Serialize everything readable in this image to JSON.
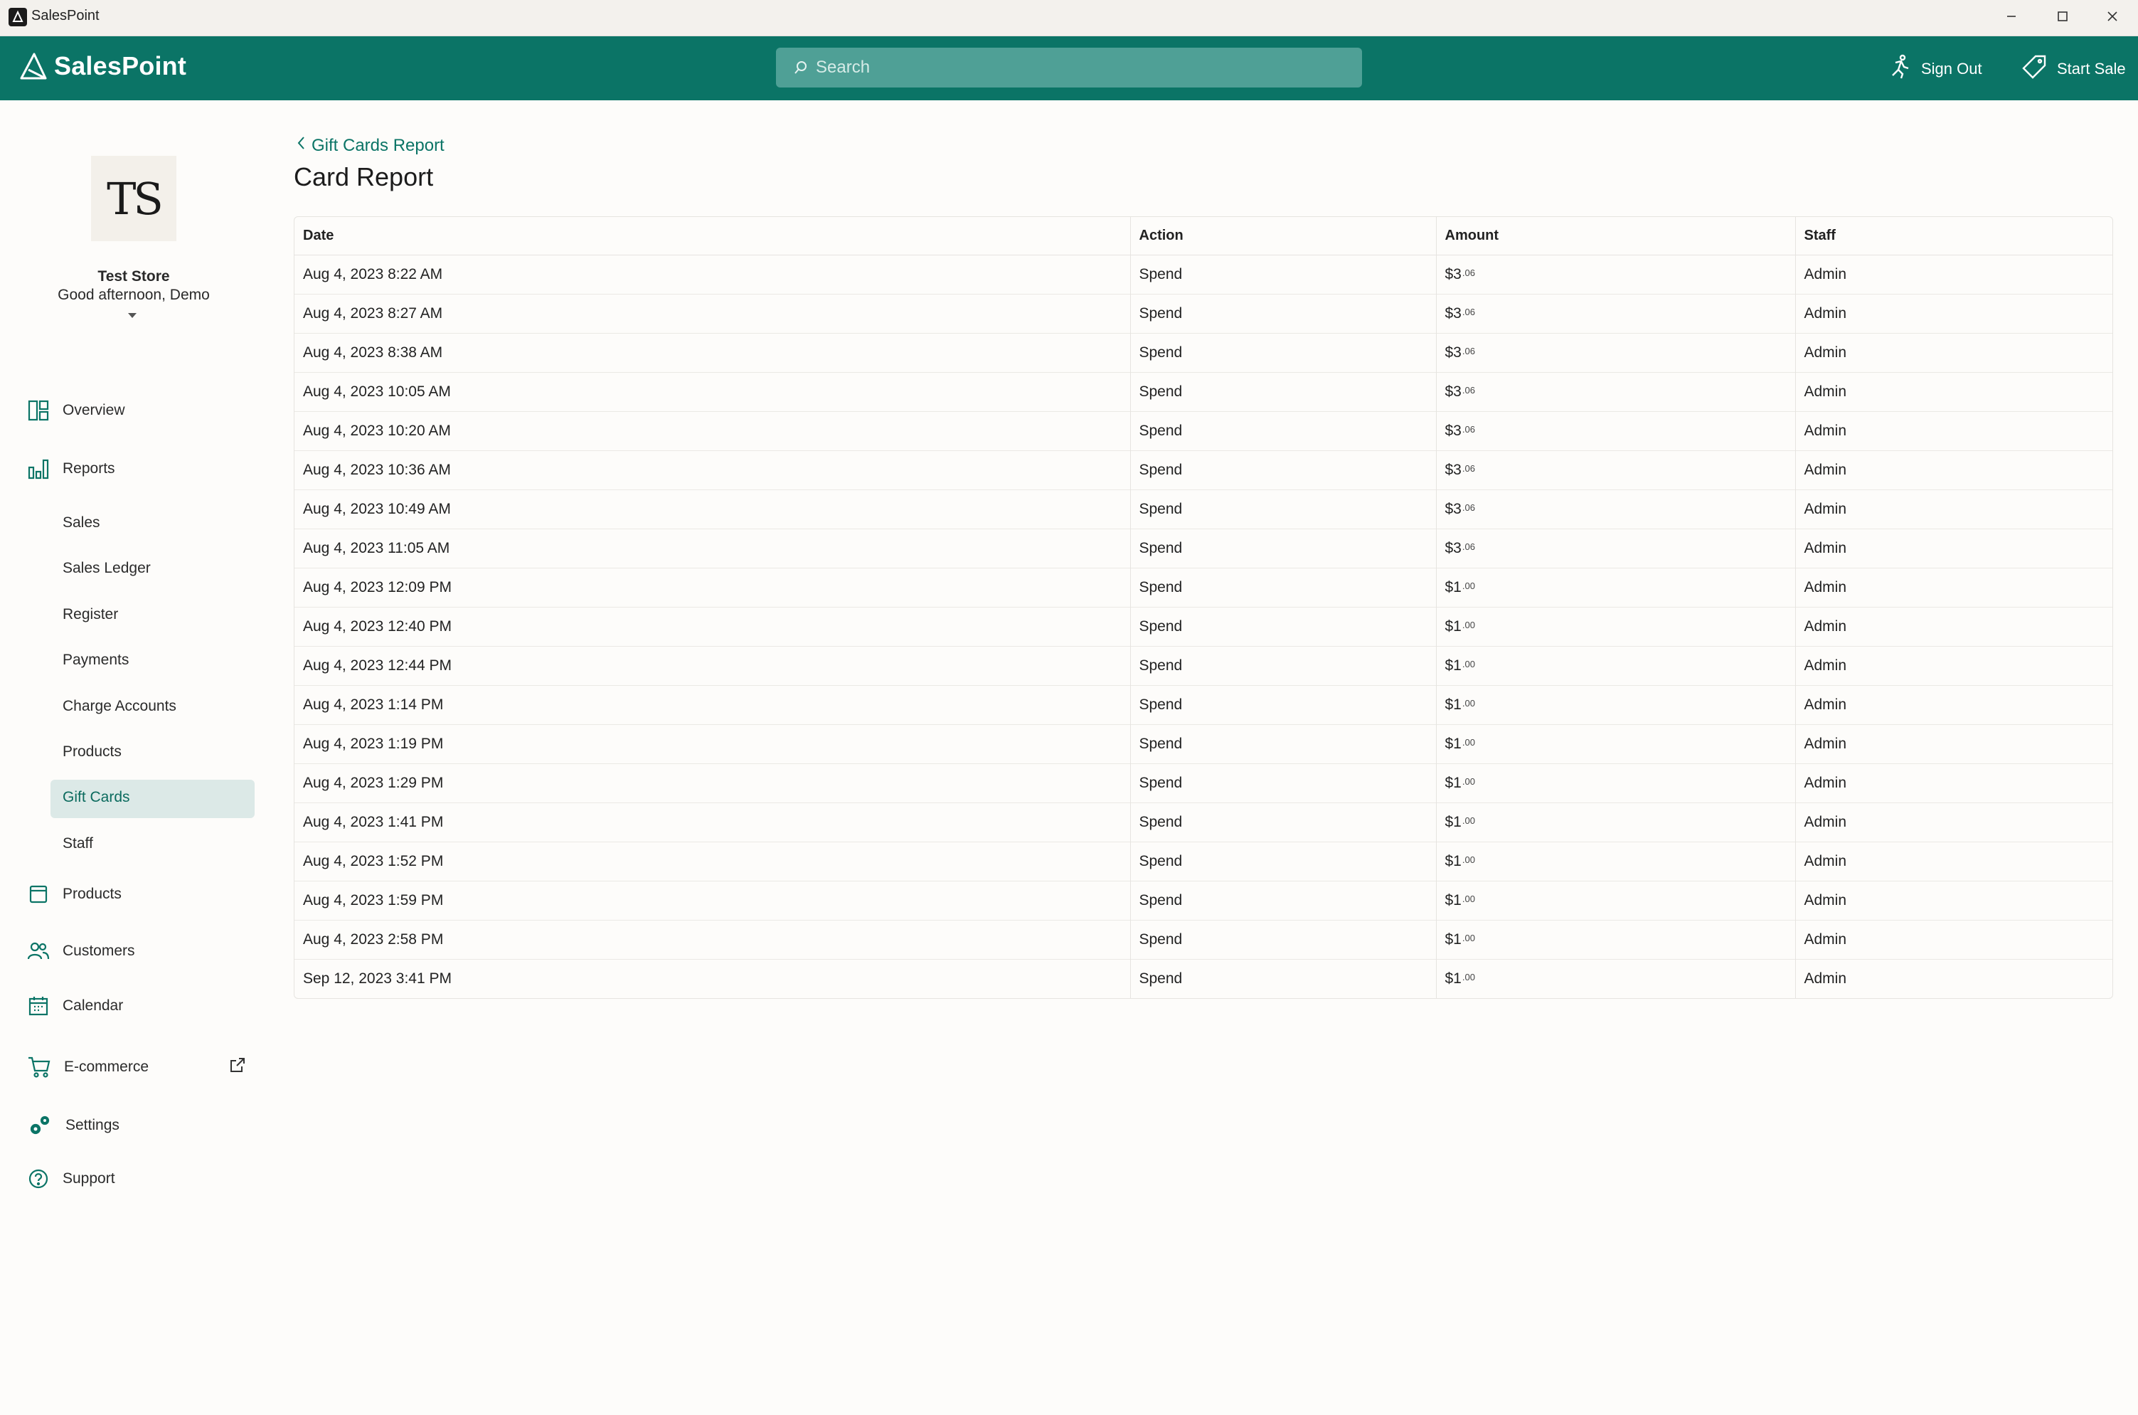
{
  "window": {
    "title": "SalesPoint"
  },
  "header": {
    "brand": "SalesPoint",
    "search_placeholder": "Search",
    "sign_out": "Sign Out",
    "start_sale": "Start Sale"
  },
  "store": {
    "initials": "TS",
    "name": "Test Store",
    "greeting": "Good afternoon, Demo"
  },
  "nav": {
    "overview": "Overview",
    "reports": "Reports",
    "report_items": [
      "Sales",
      "Sales Ledger",
      "Register",
      "Payments",
      "Charge Accounts",
      "Products",
      "Gift Cards",
      "Staff"
    ],
    "active_report_item": "Gift Cards",
    "products": "Products",
    "customers": "Customers",
    "calendar": "Calendar",
    "ecommerce": "E-commerce",
    "settings": "Settings",
    "support": "Support"
  },
  "main": {
    "back_link": "Gift Cards Report",
    "title": "Card Report",
    "columns": [
      "Date",
      "Action",
      "Amount",
      "Staff"
    ],
    "rows": [
      {
        "date": "Aug 4, 2023 8:22 AM",
        "action": "Spend",
        "dollars": "$3",
        "cents": ".06",
        "staff": "Admin"
      },
      {
        "date": "Aug 4, 2023 8:27 AM",
        "action": "Spend",
        "dollars": "$3",
        "cents": ".06",
        "staff": "Admin"
      },
      {
        "date": "Aug 4, 2023 8:38 AM",
        "action": "Spend",
        "dollars": "$3",
        "cents": ".06",
        "staff": "Admin"
      },
      {
        "date": "Aug 4, 2023 10:05 AM",
        "action": "Spend",
        "dollars": "$3",
        "cents": ".06",
        "staff": "Admin"
      },
      {
        "date": "Aug 4, 2023 10:20 AM",
        "action": "Spend",
        "dollars": "$3",
        "cents": ".06",
        "staff": "Admin"
      },
      {
        "date": "Aug 4, 2023 10:36 AM",
        "action": "Spend",
        "dollars": "$3",
        "cents": ".06",
        "staff": "Admin"
      },
      {
        "date": "Aug 4, 2023 10:49 AM",
        "action": "Spend",
        "dollars": "$3",
        "cents": ".06",
        "staff": "Admin"
      },
      {
        "date": "Aug 4, 2023 11:05 AM",
        "action": "Spend",
        "dollars": "$3",
        "cents": ".06",
        "staff": "Admin"
      },
      {
        "date": "Aug 4, 2023 12:09 PM",
        "action": "Spend",
        "dollars": "$1",
        "cents": ".00",
        "staff": "Admin"
      },
      {
        "date": "Aug 4, 2023 12:40 PM",
        "action": "Spend",
        "dollars": "$1",
        "cents": ".00",
        "staff": "Admin"
      },
      {
        "date": "Aug 4, 2023 12:44 PM",
        "action": "Spend",
        "dollars": "$1",
        "cents": ".00",
        "staff": "Admin"
      },
      {
        "date": "Aug 4, 2023 1:14 PM",
        "action": "Spend",
        "dollars": "$1",
        "cents": ".00",
        "staff": "Admin"
      },
      {
        "date": "Aug 4, 2023 1:19 PM",
        "action": "Spend",
        "dollars": "$1",
        "cents": ".00",
        "staff": "Admin"
      },
      {
        "date": "Aug 4, 2023 1:29 PM",
        "action": "Spend",
        "dollars": "$1",
        "cents": ".00",
        "staff": "Admin"
      },
      {
        "date": "Aug 4, 2023 1:41 PM",
        "action": "Spend",
        "dollars": "$1",
        "cents": ".00",
        "staff": "Admin"
      },
      {
        "date": "Aug 4, 2023 1:52 PM",
        "action": "Spend",
        "dollars": "$1",
        "cents": ".00",
        "staff": "Admin"
      },
      {
        "date": "Aug 4, 2023 1:59 PM",
        "action": "Spend",
        "dollars": "$1",
        "cents": ".00",
        "staff": "Admin"
      },
      {
        "date": "Aug 4, 2023 2:58 PM",
        "action": "Spend",
        "dollars": "$1",
        "cents": ".00",
        "staff": "Admin"
      },
      {
        "date": "Sep 12, 2023 3:41 PM",
        "action": "Spend",
        "dollars": "$1",
        "cents": ".00",
        "staff": "Admin"
      }
    ]
  },
  "colors": {
    "brand": "#0b7466",
    "active_bg": "#dce9e7"
  }
}
